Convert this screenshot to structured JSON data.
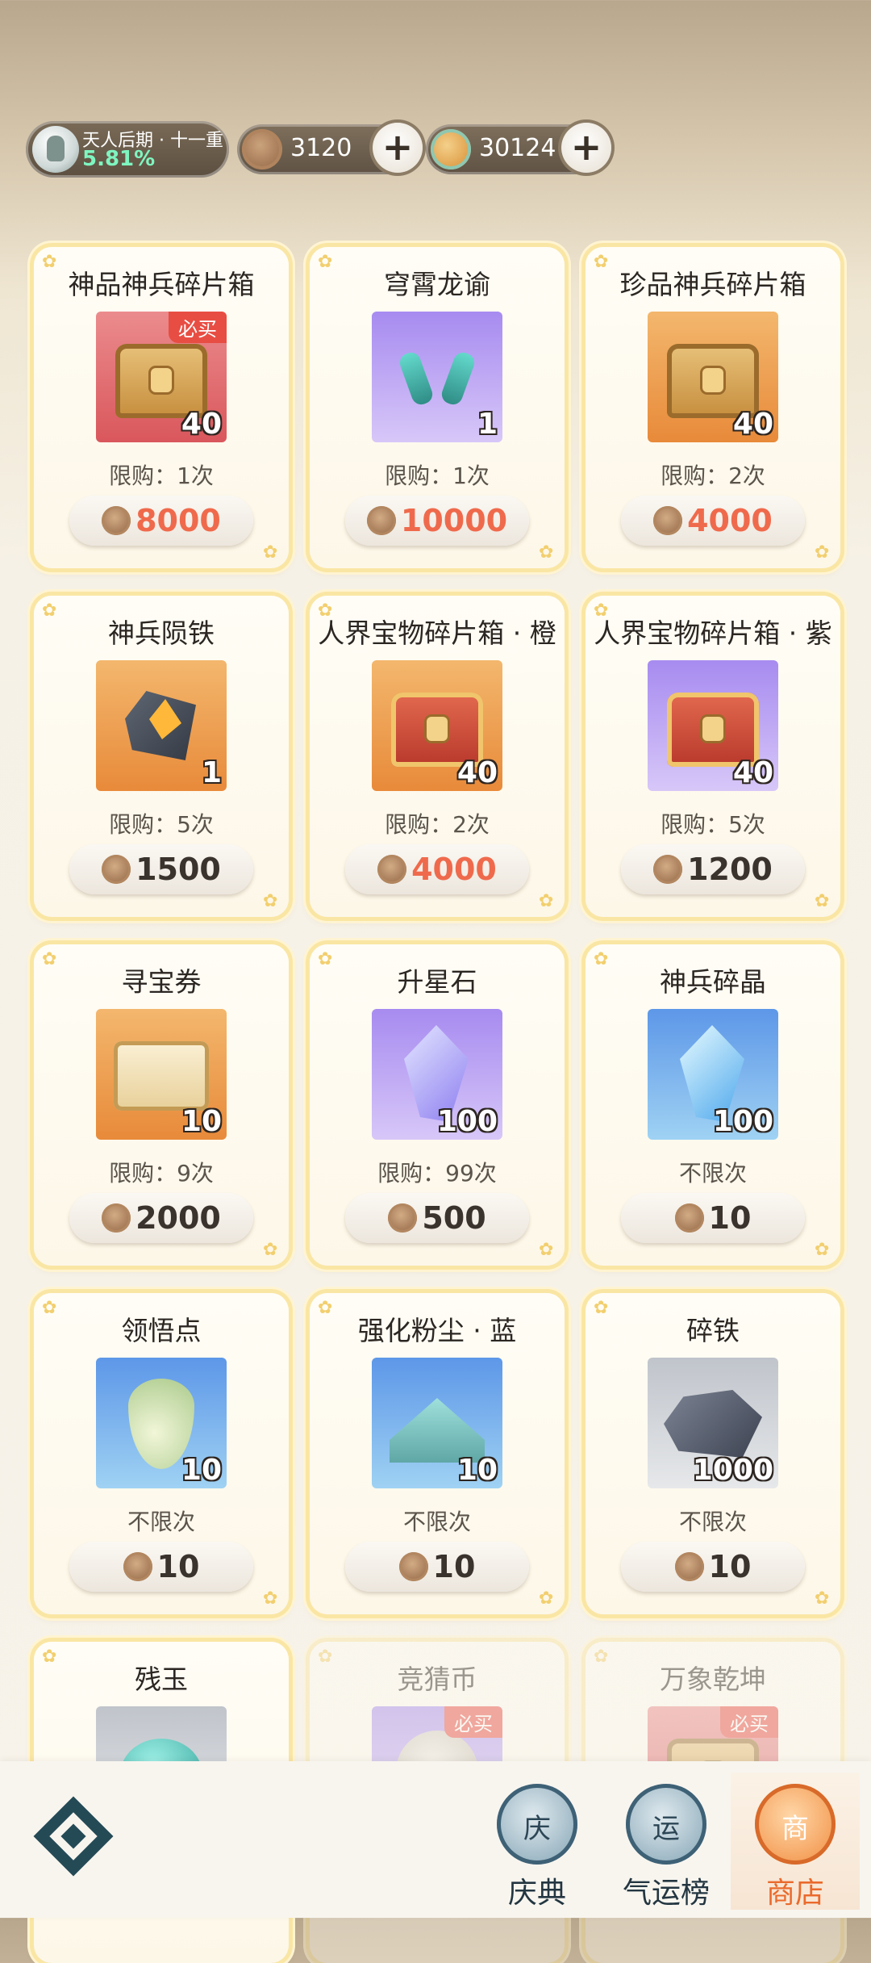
{
  "status": {
    "realm_title": "天人后期 · 十一重",
    "realm_percent": "5.81%",
    "currency_copper": "3120",
    "currency_jade": "30124",
    "plus": "+"
  },
  "shop_items": [
    {
      "name": "神品神兵碎片箱",
      "qty": "40",
      "limit": "限购：1次",
      "price": "8000",
      "tag": "必买"
    },
    {
      "name": "穹霄龙谕",
      "qty": "1",
      "limit": "限购：1次",
      "price": "10000"
    },
    {
      "name": "珍品神兵碎片箱",
      "qty": "40",
      "limit": "限购：2次",
      "price": "4000"
    },
    {
      "name": "神兵陨铁",
      "qty": "1",
      "limit": "限购：5次",
      "price": "1500"
    },
    {
      "name": "人界宝物碎片箱 · 橙",
      "qty": "40",
      "limit": "限购：2次",
      "price": "4000"
    },
    {
      "name": "人界宝物碎片箱 · 紫",
      "qty": "40",
      "limit": "限购：5次",
      "price": "1200"
    },
    {
      "name": "寻宝券",
      "qty": "10",
      "limit": "限购：9次",
      "price": "2000"
    },
    {
      "name": "升星石",
      "qty": "100",
      "limit": "限购：99次",
      "price": "500"
    },
    {
      "name": "神兵碎晶",
      "qty": "100",
      "limit": "不限次",
      "price": "10"
    },
    {
      "name": "领悟点",
      "qty": "10",
      "limit": "不限次",
      "price": "10"
    },
    {
      "name": "强化粉尘 · 蓝",
      "qty": "10",
      "limit": "不限次",
      "price": "10"
    },
    {
      "name": "碎铁",
      "qty": "1000",
      "limit": "不限次",
      "price": "10"
    },
    {
      "name": "残玉"
    },
    {
      "name": "竞猜币",
      "tag": "必买"
    },
    {
      "name": "万象乾坤",
      "tag": "必买"
    }
  ],
  "nav": {
    "celebration": "庆典",
    "celebration_glyph": "庆",
    "fortune": "气运榜",
    "fortune_glyph": "运",
    "shop": "商店",
    "shop_glyph": "商"
  },
  "colors": {
    "accent": "#ea6a2c",
    "price_highlight": "#ef6a4c",
    "card_border": "#fae6a4"
  }
}
